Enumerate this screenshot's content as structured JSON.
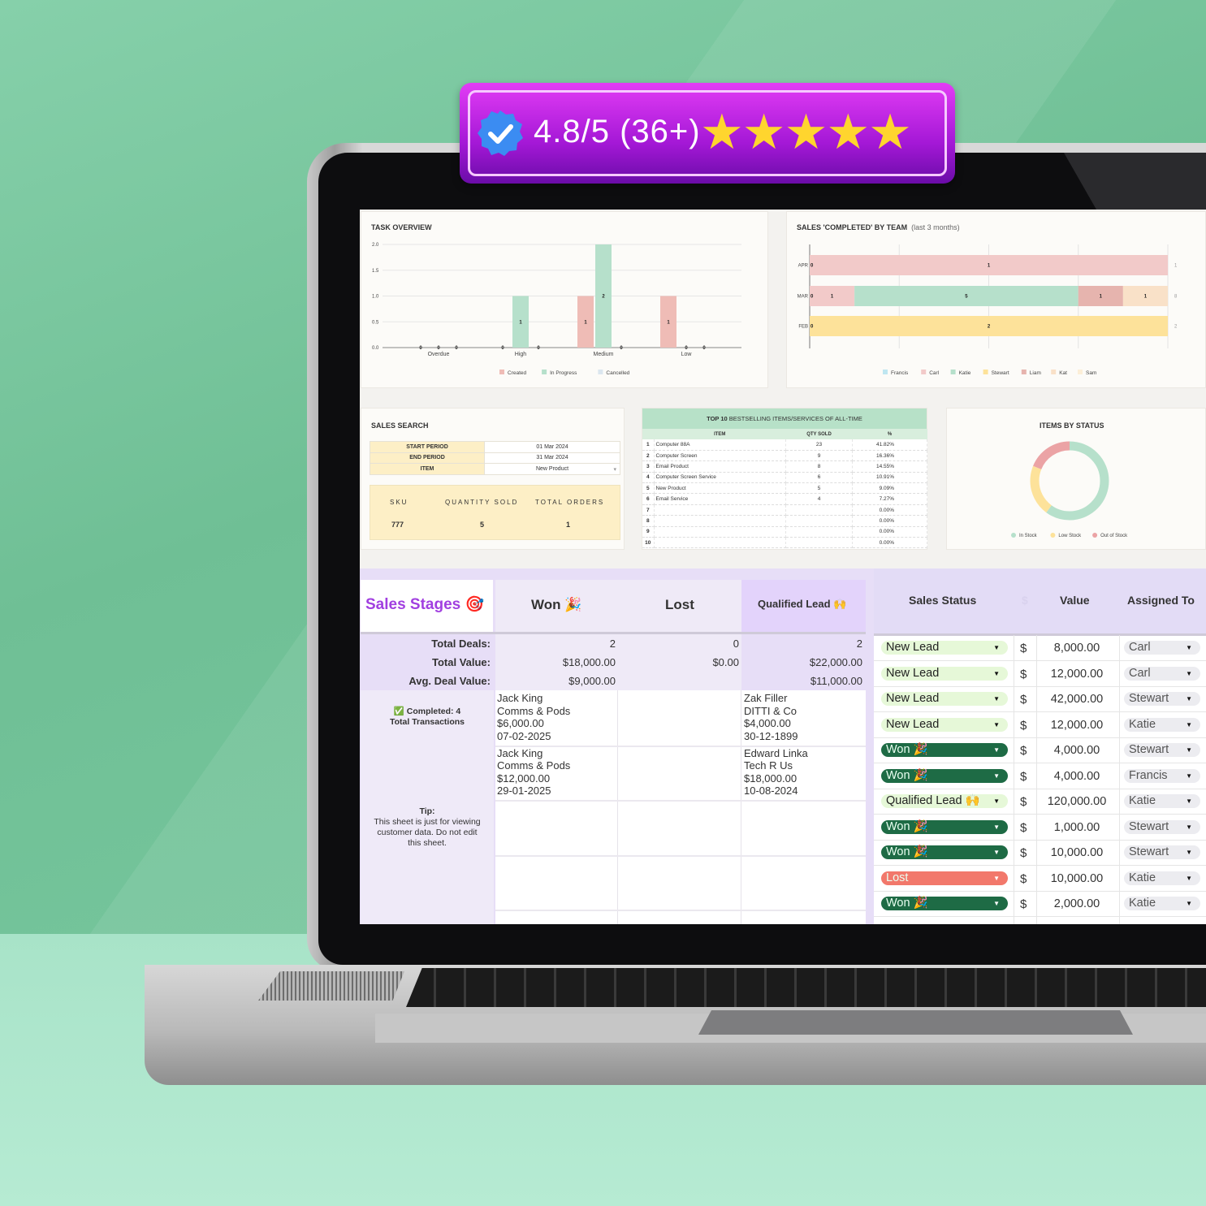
{
  "badge": {
    "rating": "4.8/5 (36+)",
    "stars": "★★★★★",
    "icon": "verified-check-icon"
  },
  "task_overview": {
    "title": "TASK OVERVIEW"
  },
  "sales_team": {
    "title": "SALES 'COMPLETED' BY TEAM",
    "subtitle": "(last 3 months)"
  },
  "sales_search": {
    "title": "SALES SEARCH",
    "fields": [
      {
        "label": "START PERIOD",
        "value": "01 Mar 2024"
      },
      {
        "label": "END PERIOD",
        "value": "31 Mar 2024"
      },
      {
        "label": "ITEM",
        "value": "New Product"
      }
    ],
    "summary_headers": [
      "SKU",
      "QUANTITY SOLD",
      "TOTAL ORDERS"
    ],
    "summary_values": [
      "777",
      "5",
      "1"
    ]
  },
  "top10": {
    "title_bold": "TOP 10",
    "title_rest": "BESTSELLING ITEMS/SERVICES OF ALL-TIME",
    "headers": [
      "ITEM",
      "QTY SOLD",
      "%"
    ],
    "rows": [
      [
        "1",
        "Computer 88A",
        "23",
        "41.82%"
      ],
      [
        "2",
        "Computer Screen",
        "9",
        "16.36%"
      ],
      [
        "3",
        "Email Product",
        "8",
        "14.55%"
      ],
      [
        "4",
        "Computer Screen Service",
        "6",
        "10.91%"
      ],
      [
        "5",
        "New Product",
        "5",
        "9.09%"
      ],
      [
        "6",
        "Email Service",
        "4",
        "7.27%"
      ],
      [
        "7",
        "",
        "",
        "0.00%"
      ],
      [
        "8",
        "",
        "",
        "0.00%"
      ],
      [
        "9",
        "",
        "",
        "0.00%"
      ],
      [
        "10",
        "",
        "",
        "0.00%"
      ]
    ]
  },
  "items_status": {
    "title": "ITEMS BY STATUS"
  },
  "stages": {
    "title": "Sales Stages 🎯",
    "cols": [
      "Won 🎉",
      "Lost",
      "Qualified Lead 🙌"
    ],
    "stat_labels": [
      "Total Deals:",
      "Total Value:",
      "Avg. Deal Value:"
    ],
    "won": [
      "2",
      "$18,000.00",
      "$9,000.00"
    ],
    "lost": [
      "0",
      "$0.00",
      ""
    ],
    "qualified": [
      "2",
      "$22,000.00",
      "$11,000.00"
    ],
    "completed": "✅ Completed: 4",
    "total_tx": "Total Transactions",
    "tip_title": "Tip:",
    "tip_text": "This sheet is just for viewing customer data. Do not edit this sheet.",
    "won_cards": [
      [
        "Jack King",
        "Comms & Pods",
        "$6,000.00",
        "07-02-2025"
      ],
      [
        "Jack King",
        "Comms & Pods",
        "$12,000.00",
        "29-01-2025"
      ]
    ],
    "qualified_cards": [
      [
        "Zak Filler",
        "DITTI & Co",
        "$4,000.00",
        "30-12-1899"
      ],
      [
        "Edward Linka",
        "Tech R Us",
        "$18,000.00",
        "10-08-2024"
      ]
    ]
  },
  "deals": {
    "headers": [
      "Sales Status",
      "$",
      "Value",
      "Assigned To"
    ],
    "currency": "$",
    "rows": [
      [
        "New Lead",
        "8,000.00",
        "Carl"
      ],
      [
        "New Lead",
        "12,000.00",
        "Carl"
      ],
      [
        "New Lead",
        "42,000.00",
        "Stewart"
      ],
      [
        "New Lead",
        "12,000.00",
        "Katie"
      ],
      [
        "Won 🎉",
        "4,000.00",
        "Stewart"
      ],
      [
        "Won 🎉",
        "4,000.00",
        "Francis"
      ],
      [
        "Qualified Lead 🙌",
        "120,000.00",
        "Katie"
      ],
      [
        "Won 🎉",
        "1,000.00",
        "Stewart"
      ],
      [
        "Won 🎉",
        "10,000.00",
        "Stewart"
      ],
      [
        "Lost",
        "10,000.00",
        "Katie"
      ],
      [
        "Won 🎉",
        "2,000.00",
        "Katie"
      ]
    ],
    "status_colors": {
      "New Lead": "#e6f8d8",
      "Won 🎉": "#1e6b45",
      "Qualified Lead 🙌": "#e6f8d8",
      "Lost": "#f2786b"
    }
  },
  "chart_data": [
    {
      "type": "bar",
      "title": "TASK OVERVIEW",
      "categories": [
        "Overdue",
        "High",
        "Medium",
        "Low"
      ],
      "ylim": [
        0,
        2
      ],
      "yticks": [
        "0.0",
        "0.5",
        "1.0",
        "1.5",
        "2.0"
      ],
      "grid": true,
      "legend": "bottom",
      "series": [
        {
          "name": "Created",
          "color": "#efbcb6",
          "values": [
            0,
            0,
            1,
            1
          ]
        },
        {
          "name": "In Progress",
          "color": "#b6e0cb",
          "values": [
            0,
            1,
            2,
            0
          ]
        },
        {
          "name": "Cancelled",
          "color": "#dbe6ef",
          "values": [
            0,
            0,
            0,
            0
          ]
        }
      ]
    },
    {
      "type": "bar",
      "orientation": "horizontal",
      "stacked": "percent",
      "title": "SALES 'COMPLETED' BY TEAM",
      "subtitle": "(last 3 months)",
      "categories": [
        "APR",
        "MAR",
        "FEB"
      ],
      "totals": [
        1,
        8,
        2
      ],
      "legend": "bottom",
      "series": [
        {
          "name": "Francis",
          "color": "#bfe6f0",
          "values": [
            0,
            0,
            0
          ]
        },
        {
          "name": "Carl",
          "color": "#f2cac9",
          "values": [
            1,
            1,
            0
          ]
        },
        {
          "name": "Katie",
          "color": "#b6e0cb",
          "values": [
            0,
            5,
            0
          ]
        },
        {
          "name": "Stewart",
          "color": "#fde29a",
          "values": [
            0,
            0,
            2
          ]
        },
        {
          "name": "Liam",
          "color": "#e6b4ae",
          "values": [
            0,
            1,
            0
          ]
        },
        {
          "name": "Kat",
          "color": "#f9e1c8",
          "values": [
            0,
            1,
            0
          ]
        },
        {
          "name": "Sam",
          "color": "#fcefd8",
          "values": [
            0,
            0,
            0
          ]
        }
      ]
    },
    {
      "type": "pie",
      "donut": true,
      "title": "ITEMS BY STATUS",
      "legend": "bottom",
      "series": [
        {
          "name": "In Stock",
          "color": "#b6e0cb",
          "percent": 60
        },
        {
          "name": "Low Stock",
          "color": "#fde29a",
          "percent": 21
        },
        {
          "name": "Out of Stock",
          "color": "#eba3a5",
          "percent": 19
        }
      ]
    }
  ]
}
